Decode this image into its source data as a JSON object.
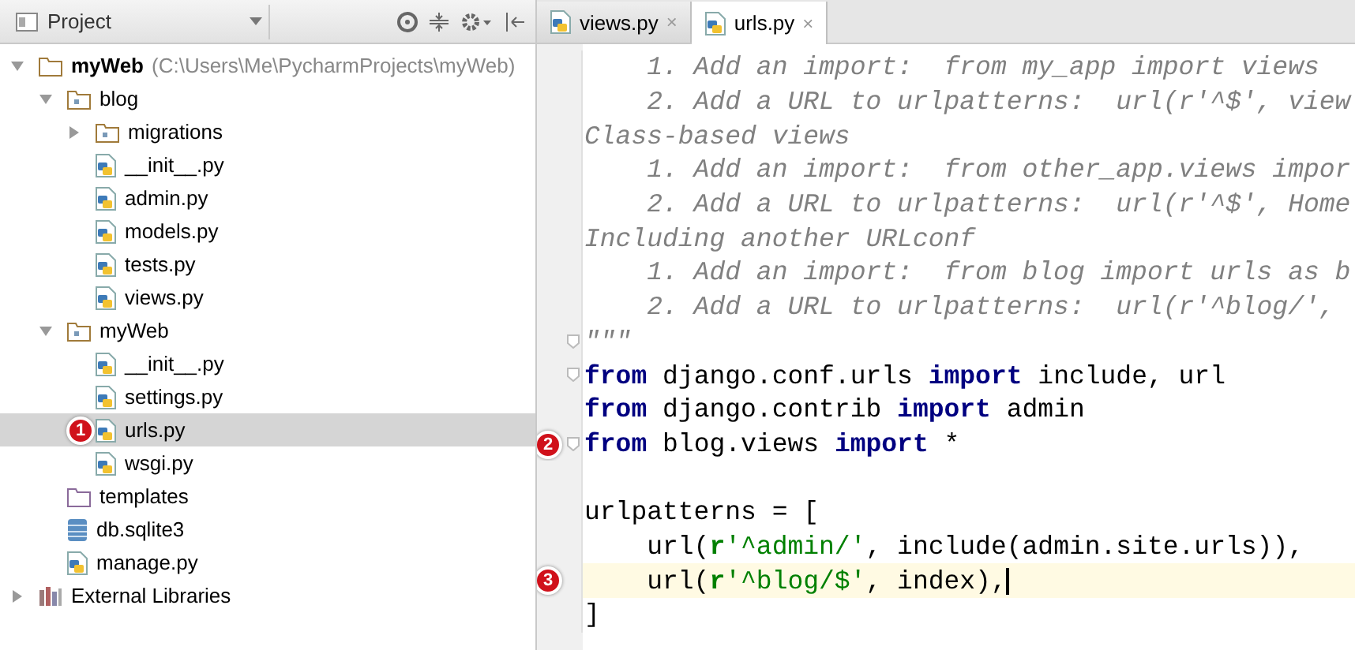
{
  "project_panel": {
    "title": "Project"
  },
  "tree": [
    {
      "label": "myWeb",
      "path": "(C:\\Users\\Me\\PycharmProjects\\myWeb)",
      "kind": "root",
      "expanded": true,
      "selected": false,
      "children": [
        {
          "label": "blog",
          "kind": "package",
          "expanded": true,
          "selected": false,
          "children": [
            {
              "label": "migrations",
              "kind": "package",
              "expanded": false,
              "selected": false
            },
            {
              "label": "__init__.py",
              "kind": "python",
              "selected": false
            },
            {
              "label": "admin.py",
              "kind": "python",
              "selected": false
            },
            {
              "label": "models.py",
              "kind": "python",
              "selected": false
            },
            {
              "label": "tests.py",
              "kind": "python",
              "selected": false
            },
            {
              "label": "views.py",
              "kind": "python",
              "selected": false
            }
          ]
        },
        {
          "label": "myWeb",
          "kind": "package",
          "expanded": true,
          "selected": false,
          "children": [
            {
              "label": "__init__.py",
              "kind": "python",
              "selected": false
            },
            {
              "label": "settings.py",
              "kind": "python",
              "selected": false
            },
            {
              "label": "urls.py",
              "kind": "python",
              "selected": true,
              "badge": "1"
            },
            {
              "label": "wsgi.py",
              "kind": "python",
              "selected": false
            }
          ]
        },
        {
          "label": "templates",
          "kind": "folder",
          "selected": false
        },
        {
          "label": "db.sqlite3",
          "kind": "database",
          "selected": false
        },
        {
          "label": "manage.py",
          "kind": "python",
          "selected": false
        }
      ]
    },
    {
      "label": "External Libraries",
      "kind": "library",
      "expanded": false,
      "selected": false
    }
  ],
  "tabs": [
    {
      "label": "views.py",
      "selected": false,
      "close": "×"
    },
    {
      "label": "urls.py",
      "selected": true,
      "close": "×"
    }
  ],
  "code": [
    {
      "current": false,
      "fold": false,
      "tokens": [
        {
          "kind": "comment",
          "text": "    1. Add an import:  from my_app import views"
        }
      ]
    },
    {
      "current": false,
      "fold": false,
      "tokens": [
        {
          "kind": "comment",
          "text": "    2. Add a URL to urlpatterns:  url(r'^$', view"
        }
      ]
    },
    {
      "current": false,
      "fold": false,
      "tokens": [
        {
          "kind": "comment",
          "text": "Class-based views"
        }
      ]
    },
    {
      "current": false,
      "fold": false,
      "tokens": [
        {
          "kind": "comment",
          "text": "    1. Add an import:  from other_app.views impor"
        }
      ]
    },
    {
      "current": false,
      "fold": false,
      "tokens": [
        {
          "kind": "comment",
          "text": "    2. Add a URL to urlpatterns:  url(r'^$', Home"
        }
      ]
    },
    {
      "current": false,
      "fold": false,
      "tokens": [
        {
          "kind": "comment",
          "text": "Including another URLconf"
        }
      ]
    },
    {
      "current": false,
      "fold": false,
      "tokens": [
        {
          "kind": "comment",
          "text": "    1. Add an import:  from blog import urls as b"
        }
      ]
    },
    {
      "current": false,
      "fold": false,
      "tokens": [
        {
          "kind": "comment",
          "text": "    2. Add a URL to urlpatterns:  url(r'^blog/',"
        }
      ]
    },
    {
      "current": false,
      "fold": true,
      "tokens": [
        {
          "kind": "comment",
          "text": "\"\"\""
        }
      ]
    },
    {
      "current": false,
      "fold": true,
      "tokens": [
        {
          "kind": "keyword",
          "text": "from"
        },
        {
          "kind": "plain",
          "text": " django.conf.urls "
        },
        {
          "kind": "keyword",
          "text": "import"
        },
        {
          "kind": "plain",
          "text": " include, url"
        }
      ]
    },
    {
      "current": false,
      "fold": false,
      "tokens": [
        {
          "kind": "keyword",
          "text": "from"
        },
        {
          "kind": "plain",
          "text": " django.contrib "
        },
        {
          "kind": "keyword",
          "text": "import"
        },
        {
          "kind": "plain",
          "text": " admin"
        }
      ]
    },
    {
      "current": false,
      "fold": true,
      "badge": "2",
      "tokens": [
        {
          "kind": "keyword",
          "text": "from"
        },
        {
          "kind": "plain",
          "text": " blog.views "
        },
        {
          "kind": "keyword",
          "text": "import"
        },
        {
          "kind": "plain",
          "text": " *"
        }
      ]
    },
    {
      "current": false,
      "fold": false
    },
    {
      "current": false,
      "fold": false,
      "tokens": [
        {
          "kind": "plain",
          "text": "urlpatterns = ["
        }
      ]
    },
    {
      "current": false,
      "fold": false,
      "tokens": [
        {
          "kind": "plain",
          "text": "    url("
        },
        {
          "kind": "prefix",
          "text": "r"
        },
        {
          "kind": "string",
          "text": "'^admin/'"
        },
        {
          "kind": "plain",
          "text": ", include(admin.site.urls)),"
        }
      ]
    },
    {
      "current": true,
      "fold": false,
      "badge": "3",
      "tokens": [
        {
          "kind": "plain",
          "text": "    url("
        },
        {
          "kind": "prefix",
          "text": "r"
        },
        {
          "kind": "string",
          "text": "'^blog/$'"
        },
        {
          "kind": "plain",
          "text": ", index),"
        }
      ]
    },
    {
      "current": false,
      "fold": false,
      "tokens": [
        {
          "kind": "plain",
          "text": "]"
        }
      ]
    }
  ]
}
